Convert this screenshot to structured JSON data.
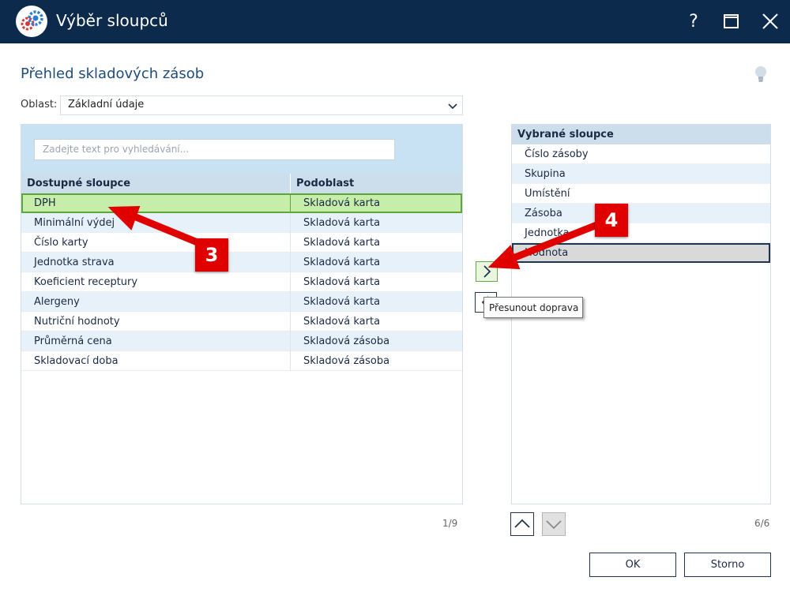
{
  "window": {
    "title": "Výběr sloupců",
    "help_label": "?"
  },
  "page": {
    "title": "Přehled skladových zásob"
  },
  "area": {
    "label": "Oblast:",
    "value": "Základní údaje"
  },
  "available": {
    "search_placeholder": "Zadejte text pro vyhledávání...",
    "headers": {
      "column": "Dostupné sloupce",
      "subarea": "Podoblast"
    },
    "rows": [
      {
        "name": "DPH",
        "subarea": "Skladová karta"
      },
      {
        "name": "Minimální výdej",
        "subarea": "Skladová karta"
      },
      {
        "name": "Číslo karty",
        "subarea": "Skladová karta"
      },
      {
        "name": "Jednotka strava",
        "subarea": "Skladová karta"
      },
      {
        "name": "Koeficient receptury",
        "subarea": "Skladová karta"
      },
      {
        "name": "Alergeny",
        "subarea": "Skladová karta"
      },
      {
        "name": "Nutriční hodnoty",
        "subarea": "Skladová karta"
      },
      {
        "name": "Průměrná cena",
        "subarea": "Skladová zásoba"
      },
      {
        "name": "Skladovací doba",
        "subarea": "Skladová zásoba"
      }
    ],
    "selected_index": 0,
    "counter": "1/9"
  },
  "selected": {
    "header": "Vybrané sloupce",
    "rows": [
      "Číslo zásoby",
      "Skupina",
      "Umístění",
      "Zásoba",
      "Jednotka",
      "Hodnota"
    ],
    "selected_index": 5,
    "counter": "6/6"
  },
  "tooltip": "Přesunout doprava",
  "buttons": {
    "ok": "OK",
    "cancel": "Storno"
  },
  "annotations": {
    "step3": "3",
    "step4": "4",
    "color": "#e00000"
  },
  "colors": {
    "titlebar": "#0c2a4c",
    "selection_green": "#c6eeaa",
    "header_blue": "#ccdeec"
  }
}
